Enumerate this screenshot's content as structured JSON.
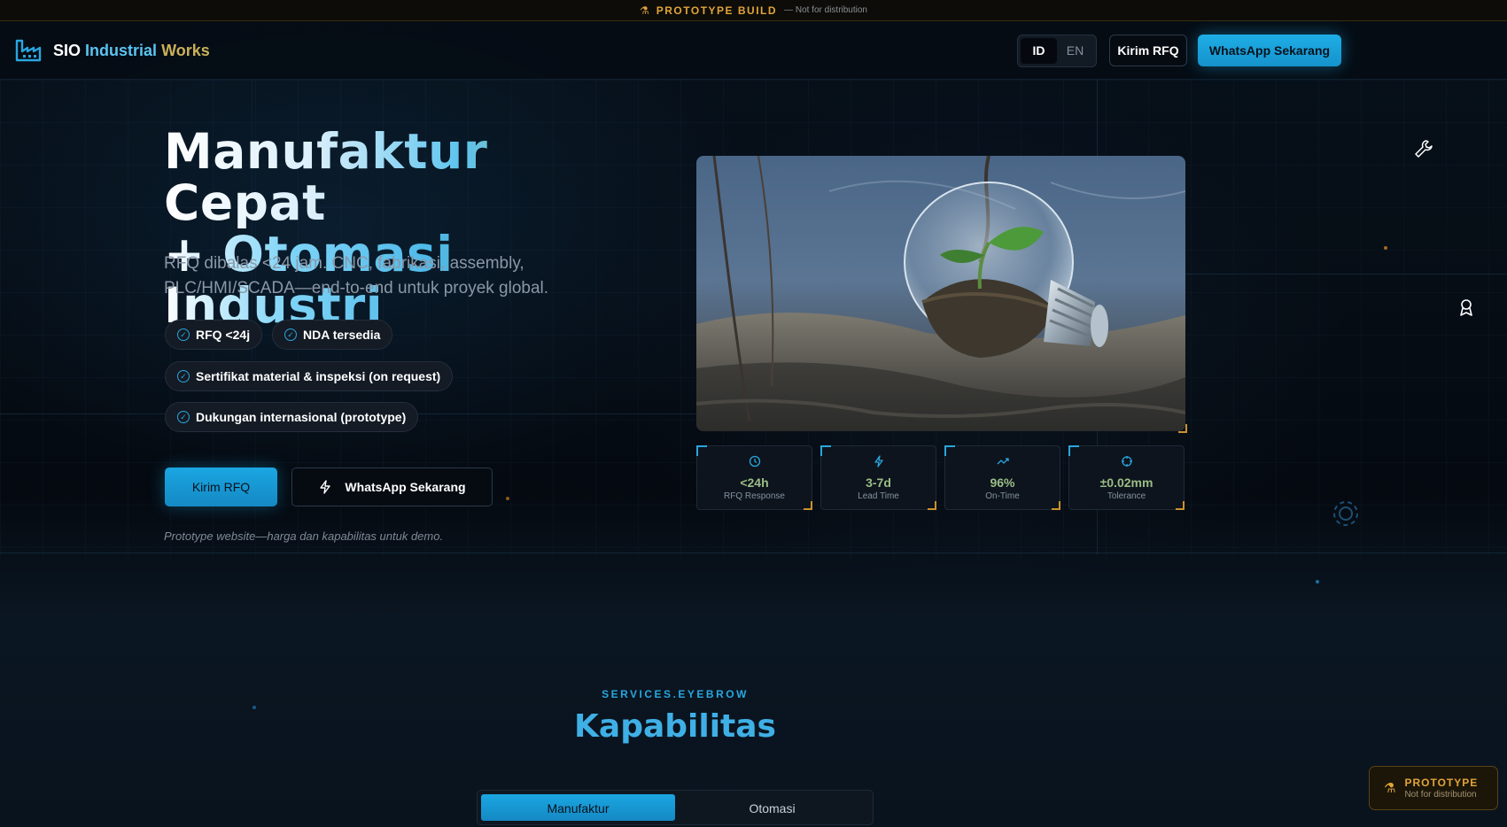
{
  "proto_bar": {
    "flask_icon": "flask-icon",
    "title": "PROTOTYPE BUILD",
    "subtitle": "— Not for distribution"
  },
  "header": {
    "brand": {
      "w1": "SIO",
      "w2": "Industrial",
      "w3": "Works"
    },
    "lang": {
      "active": "ID",
      "inactive": "EN"
    },
    "rfq_label": "Kirim RFQ",
    "whatsapp_label": "WhatsApp Sekarang"
  },
  "hero": {
    "title_line1_a": "Manufaktur",
    "title_line1_b": "Cepat",
    "title_line2_a": "+ Otomasi",
    "title_line2_b": "Industri",
    "subtitle": "RFQ dibalas <24 jam. CNC, fabrikasi, assembly, PLC/HMI/SCADA—end-to-end untuk proyek global.",
    "chips": [
      "RFQ <24j",
      "NDA tersedia",
      "Sertifikat material & inspeksi (on request)",
      "Dukungan internasional (prototype)"
    ],
    "cta_rfq": "Kirim RFQ",
    "cta_whatsapp": "WhatsApp Sekarang",
    "note": "Prototype website—harga dan kapabilitas untuk demo."
  },
  "stats": [
    {
      "icon": "clock-icon",
      "value": "<24h",
      "label": "RFQ Response"
    },
    {
      "icon": "bolt-icon",
      "value": "3-7d",
      "label": "Lead Time"
    },
    {
      "icon": "trend-up-icon",
      "value": "96%",
      "label": "On-Time"
    },
    {
      "icon": "crosshair-icon",
      "value": "±0.02mm",
      "label": "Tolerance"
    }
  ],
  "services": {
    "eyebrow": "SERVICES.EYEBROW",
    "title": "Kapabilitas",
    "tabs": [
      "Manufaktur",
      "Otomasi"
    ],
    "active_tab": "Manufaktur"
  },
  "prototype_badge": {
    "title": "PROTOTYPE",
    "subtitle": "Not for distribution"
  },
  "colors": {
    "accent": "#1eaee6",
    "gold": "#e1a43a",
    "background": "#060b12"
  }
}
